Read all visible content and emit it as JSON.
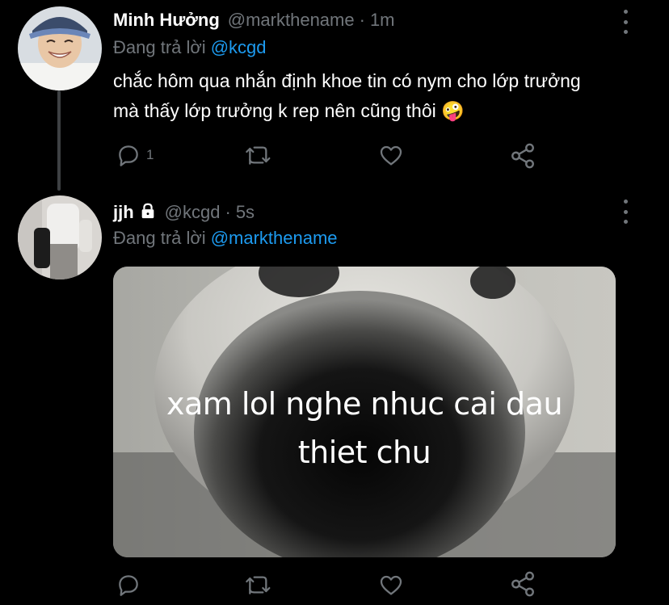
{
  "tweets": [
    {
      "name": "Minh Hưởng",
      "handle": "@markthename",
      "separator": "·",
      "time": "1m",
      "replying_label": "Đang trả lời",
      "replying_to": "@kcgd",
      "text_lines": [
        "chắc hôm qua nhắn định khoe tin có nym cho lớp trưởng",
        "mà thấy lớp trưởng k rep nên cũng thôi 🤪"
      ],
      "reply_count": "1",
      "icons": [
        "reply-icon",
        "retweet-icon",
        "like-icon",
        "share-icon",
        "more-icon"
      ]
    },
    {
      "name": "jjh",
      "handle": "@kcgd",
      "separator": "·",
      "time": "5s",
      "protected": true,
      "replying_label": "Đang trả lời",
      "replying_to": "@markthename",
      "media_caption_lines": [
        "xam lol nghe nhuc cai dau",
        "thiet chu"
      ],
      "reply_count": "",
      "icons": [
        "reply-icon",
        "retweet-icon",
        "like-icon",
        "share-icon",
        "more-icon",
        "lock-icon"
      ]
    }
  ],
  "colors": {
    "background": "#000000",
    "muted": "#71767b",
    "mention": "#1d9bf0",
    "thread_line": "#3e4144"
  }
}
